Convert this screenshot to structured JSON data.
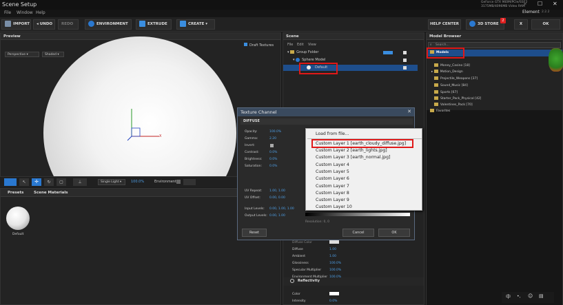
{
  "window": {
    "title": "Scene Setup",
    "menu": [
      "File",
      "Window",
      "Help"
    ],
    "gpu_line1": "GeForce GTX 960M/PCIe/SSE2",
    "gpu_line2": "3175MB/4096MB Video RAM",
    "app_name": "Element",
    "app_version": "2.2.2"
  },
  "toolbar": {
    "import": "IMPORT",
    "undo": "UNDO",
    "redo": "REDO",
    "environment": "ENVIRONMENT",
    "extrude": "EXTRUDE",
    "create": "CREATE",
    "help_center": "HELP CENTER",
    "store": "3D STORE",
    "store_badge": "2",
    "close": "X",
    "ok": "OK"
  },
  "preview": {
    "title": "Preview",
    "draft_textures": "Draft Textures",
    "view_mode": "Perspective",
    "shade_mode": "Shaded",
    "axis_x": "X",
    "light_mode": "Single Light",
    "light_value": "100.0%",
    "environment": "Environment"
  },
  "scene": {
    "title": "Scene",
    "menu": [
      "File",
      "Edit",
      "View"
    ],
    "group_folder": "Group Folder",
    "sphere_model": "Sphere Model",
    "default_material": "Default"
  },
  "bottom_tabs": {
    "presets": "Presets",
    "scene_materials": "Scene Materials",
    "default_label": "Default"
  },
  "model_browser": {
    "title": "Model Browser",
    "search_placeholder": "Search...",
    "items": [
      "Models",
      "Money_Casino [18]",
      "Motion_Design",
      "Projectile_Weapons [37]",
      "Sound_Music [84]",
      "Sports [67]",
      "Starter_Pack_Physical [42]",
      "Valentines_Pack [70]",
      "Favorites"
    ]
  },
  "texture_dialog": {
    "title": "Texture Channel",
    "section": "DIFFUSE",
    "rows": [
      {
        "label": "Opacity:",
        "value": "100.0%"
      },
      {
        "label": "Gamma:",
        "value": "2.20"
      },
      {
        "label": "Invert:",
        "value": ""
      },
      {
        "label": "Contrast:",
        "value": "0.0%"
      },
      {
        "label": "Brightness:",
        "value": "0.0%"
      },
      {
        "label": "Saturation:",
        "value": "0.0%"
      }
    ],
    "uv_repeat_label": "UV Repeat:",
    "uv_repeat_value": "1.00,  1.00",
    "uv_offset_label": "UV Offset:",
    "uv_offset_value": "0.00,  0.00",
    "input_levels_label": "Input Levels:",
    "input_levels_value": "0.00,  1.00,  1.00",
    "output_levels_label": "Output Levels:",
    "output_levels_value": "0.00,  1.00",
    "resolution": "Resolution: 0, 0",
    "reset": "Reset",
    "cancel": "Cancel",
    "ok": "OK"
  },
  "context_menu": {
    "items": [
      "Load from file...",
      "Custom Layer 1 [earth_cloudy_diffuse.jpg]",
      "Custom Layer 2 [earth_lights.jpg]",
      "Custom Layer 3 [earth_normal.jpg]",
      "Custom Layer 4",
      "Custom Layer 5",
      "Custom Layer 6",
      "Custom Layer 7",
      "Custom Layer 8",
      "Custom Layer 9",
      "Custom Layer 10"
    ]
  },
  "material_props": {
    "rows": [
      {
        "label": "Diffuse Color",
        "value": ""
      },
      {
        "label": "Diffuse",
        "value": "1.00"
      },
      {
        "label": "Ambient",
        "value": "1.00"
      },
      {
        "label": "Glossiness",
        "value": "100.0%"
      },
      {
        "label": "Specular Multiplier",
        "value": "100.0%"
      },
      {
        "label": "Environment Multiplier",
        "value": "100.0%"
      }
    ],
    "reflectivity_header": "Reflectivity",
    "color_label": "Color",
    "intensity_label": "Intensity",
    "intensity_value": "0.0%"
  },
  "colors": {
    "accent_blue": "#1e4e8c",
    "highlight_red": "#e01818",
    "value_blue": "#4fa0e8"
  }
}
